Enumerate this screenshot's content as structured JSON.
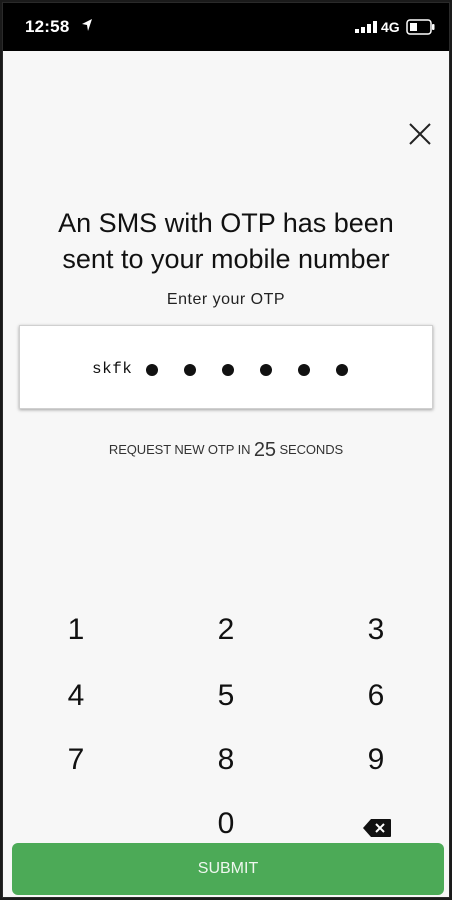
{
  "status_bar": {
    "time": "12:58",
    "network": "4G",
    "icons": [
      "location-arrow-icon",
      "signal-bars-icon",
      "battery-icon"
    ]
  },
  "header": {
    "close_icon": "close-icon"
  },
  "otp": {
    "title_line1": "An SMS with OTP has been",
    "title_line2": "sent to your mobile number",
    "label": "Enter your OTP",
    "typed_text": "skfk",
    "masked_digits": 6
  },
  "resend": {
    "prefix": "REQUEST NEW OTP IN ",
    "seconds": "25",
    "suffix": " SECONDS"
  },
  "keypad": {
    "keys": [
      "1",
      "2",
      "3",
      "4",
      "5",
      "6",
      "7",
      "8",
      "9",
      "0"
    ],
    "backspace_icon": "backspace-icon"
  },
  "submit_label": "SUBMIT",
  "colors": {
    "primary": "#4caa57",
    "background": "#f7f7f7",
    "status_bar": "#000000"
  }
}
